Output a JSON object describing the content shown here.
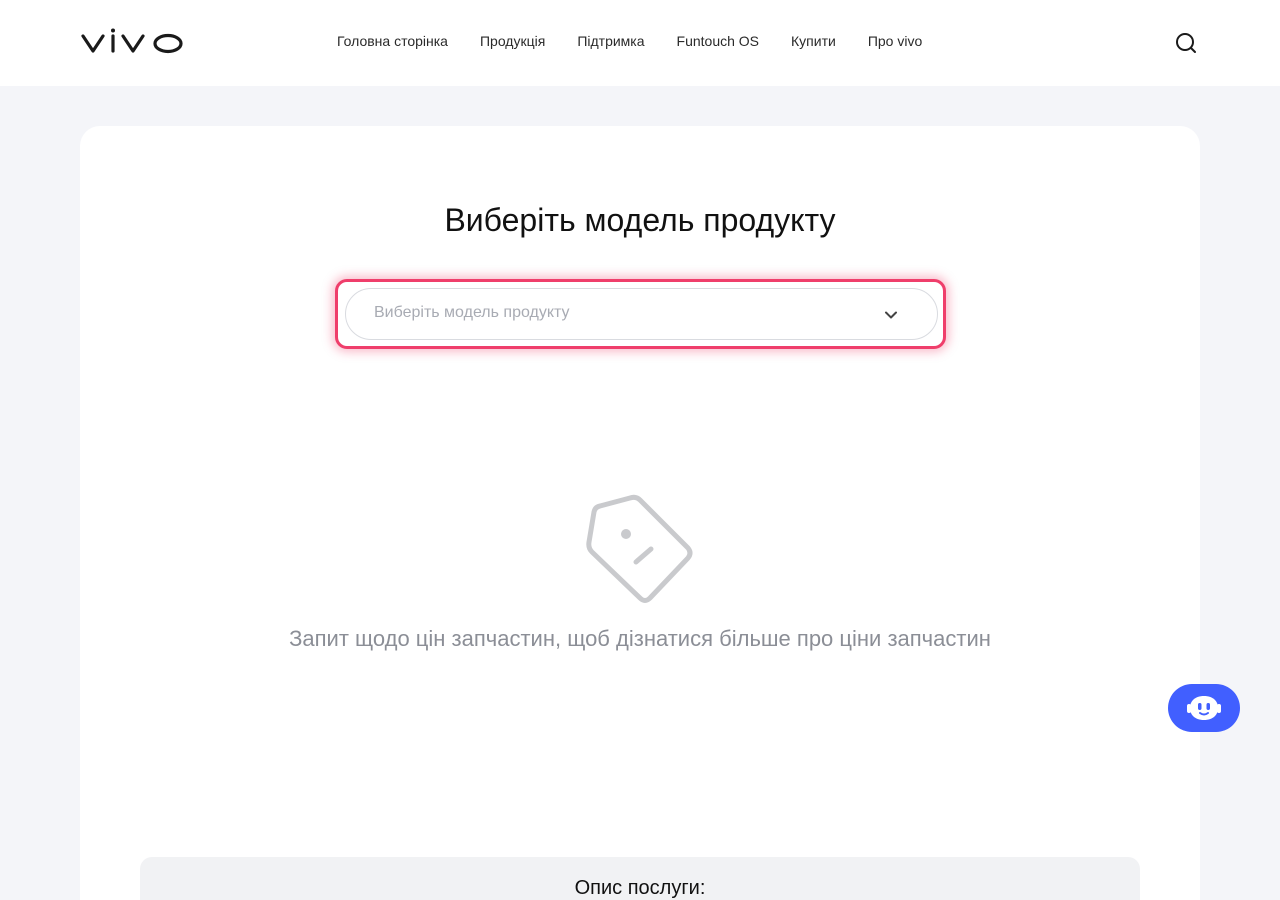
{
  "header": {
    "logo_text": "vivo",
    "nav": [
      {
        "label": "Головна сторінка"
      },
      {
        "label": "Продукція"
      },
      {
        "label": "Підтримка"
      },
      {
        "label": "Funtouch OS"
      },
      {
        "label": "Купити"
      },
      {
        "label": "Про vivo"
      }
    ],
    "search_icon": "search-icon"
  },
  "main": {
    "title": "Виберіть модель продукту",
    "select": {
      "placeholder": "Виберіть модель продукту",
      "value": "",
      "icon": "chevron-down-icon"
    },
    "empty_state": {
      "icon": "price-tag-icon",
      "text": "Запит щодо цін запчастин, щоб дізнатися більше про ціни запчастин"
    },
    "description": {
      "title": "Опис послуги:"
    }
  },
  "chat": {
    "icon": "chatbot-icon"
  },
  "colors": {
    "accent": "#ef3e6b",
    "chat_button": "#415fff",
    "background": "#f4f5f9"
  }
}
